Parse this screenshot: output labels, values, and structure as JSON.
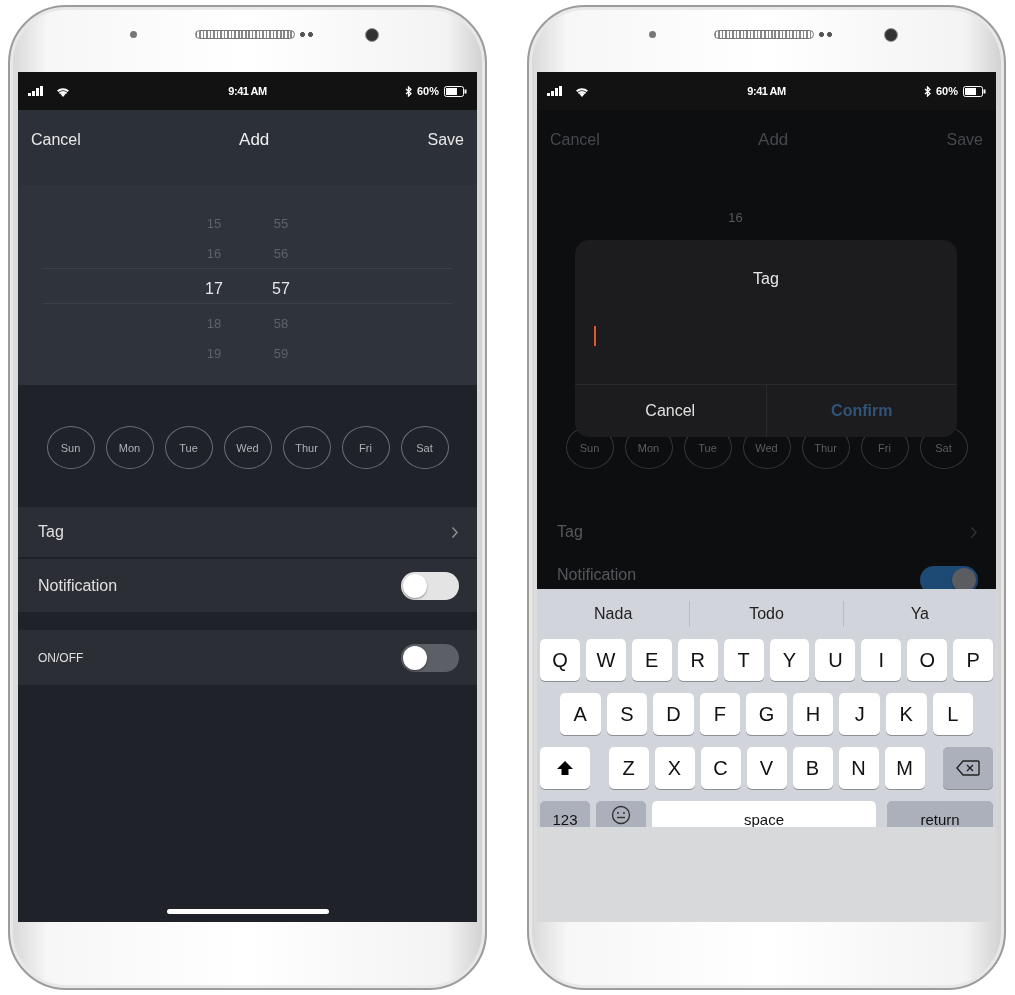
{
  "left_screen": {
    "status_bar": {
      "time": "9:41 AM",
      "battery": "60%"
    },
    "nav": {
      "cancel": "Cancel",
      "title": "Add",
      "save": "Save"
    },
    "picker": {
      "hours": [
        {
          "label": "15",
          "selected": false
        },
        {
          "label": "16",
          "selected": false
        },
        {
          "label": "17",
          "selected": true
        },
        {
          "label": "18",
          "selected": false
        },
        {
          "label": "19",
          "selected": false
        }
      ],
      "minutes": [
        {
          "label": "55",
          "selected": false
        },
        {
          "label": "56",
          "selected": false
        },
        {
          "label": "57",
          "selected": true
        },
        {
          "label": "58",
          "selected": false
        },
        {
          "label": "59",
          "selected": false
        }
      ]
    },
    "days": [
      {
        "label": "Sun",
        "selected": false
      },
      {
        "label": "Mon",
        "selected": false
      },
      {
        "label": "Tue",
        "selected": false
      },
      {
        "label": "Wed",
        "selected": false
      },
      {
        "label": "Thur",
        "selected": false
      },
      {
        "label": "Fri",
        "selected": false
      },
      {
        "label": "Sat",
        "selected": false
      }
    ],
    "rows": [
      {
        "kind": "link",
        "label": "Tag"
      },
      {
        "kind": "toggle",
        "label": "Notification",
        "on": false
      }
    ],
    "power": {
      "label": "ON/OFF",
      "on": false
    }
  },
  "right_screen": {
    "status_bar": {
      "time": "9:41 AM",
      "battery": "60%"
    },
    "nav": {
      "cancel": "Cancel",
      "title": "Add",
      "save": "Save"
    },
    "picker": {
      "hours": [
        {
          "label": "16",
          "selected": false
        }
      ]
    },
    "days": [
      {
        "label": "Sun",
        "selected": false
      },
      {
        "label": "Mon",
        "selected": false
      },
      {
        "label": "Tue",
        "selected": false
      },
      {
        "label": "Wed",
        "selected": false
      },
      {
        "label": "Thur",
        "selected": false
      },
      {
        "label": "Fri",
        "selected": false
      },
      {
        "label": "Sat",
        "selected": false
      }
    ],
    "rows": [
      {
        "kind": "link",
        "label": "Tag"
      },
      {
        "kind": "toggle",
        "label": "Notification",
        "on": true
      }
    ],
    "dialog": {
      "title": "Tag",
      "input": {
        "focused": true
      },
      "buttons": [
        {
          "kind": "cancel",
          "label": "Cancel"
        },
        {
          "kind": "confirm",
          "label": "Confirm"
        }
      ]
    },
    "keyboard": {
      "suggestions": [
        "Nada",
        "Todo",
        "Ya"
      ],
      "rows": [
        [
          "Q",
          "W",
          "E",
          "R",
          "T",
          "Y",
          "U",
          "I",
          "O",
          "P"
        ],
        [
          "A",
          "S",
          "D",
          "F",
          "G",
          "H",
          "J",
          "K",
          "L"
        ],
        [
          "Z",
          "X",
          "C",
          "V",
          "B",
          "N",
          "M"
        ]
      ],
      "numbers": "123",
      "space": "space",
      "return": "return"
    }
  }
}
